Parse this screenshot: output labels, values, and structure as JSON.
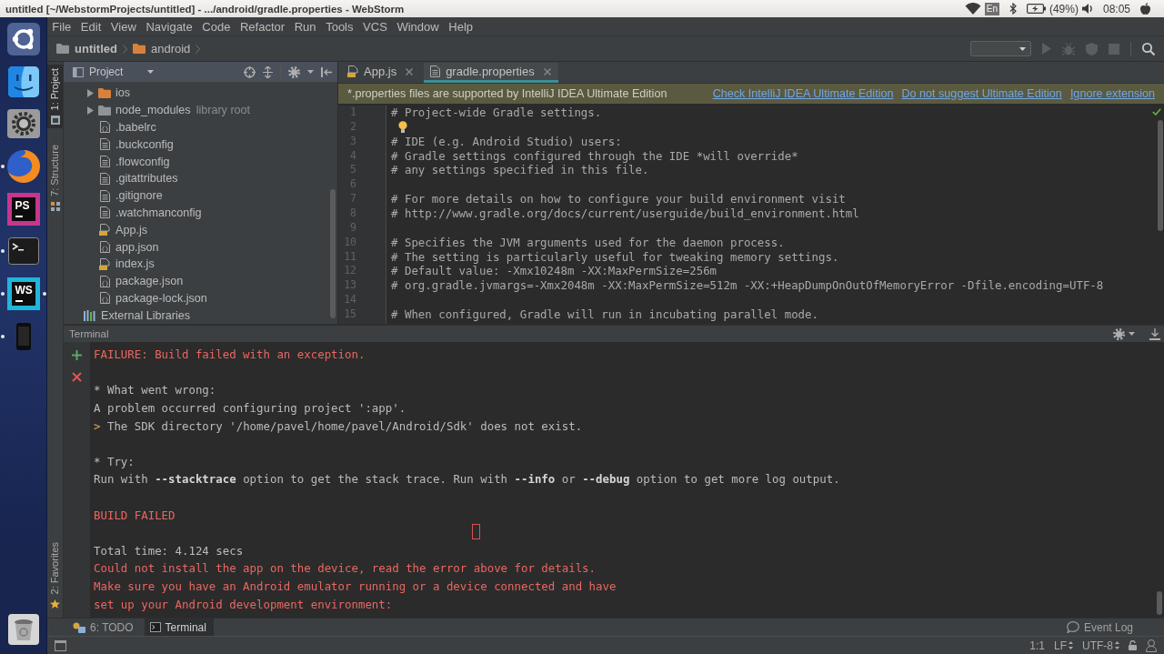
{
  "top_bar": {
    "title": "untitled [~/WebstormProjects/untitled] - .../android/gradle.properties - WebStorm",
    "keyboard_layout": "En",
    "battery": "(49%)",
    "clock": "08:05"
  },
  "launcher": {
    "items": [
      {
        "kind": "dash",
        "running": false,
        "focused": false
      },
      {
        "kind": "files",
        "running": false,
        "focused": false
      },
      {
        "kind": "settings",
        "running": false,
        "focused": false
      },
      {
        "kind": "browser",
        "running": true,
        "focused": false
      },
      {
        "kind": "ide",
        "label": "PS",
        "color": "#c8358e",
        "running": false,
        "focused": false
      },
      {
        "kind": "terminal",
        "running": true,
        "focused": false
      },
      {
        "kind": "ide",
        "label": "WS",
        "color": "#1fb5dc",
        "running": true,
        "focused": true
      },
      {
        "kind": "phone",
        "running": true,
        "focused": false
      }
    ],
    "bottom_items": [
      {
        "kind": "trash",
        "running": false,
        "focused": false
      }
    ]
  },
  "menu": [
    "File",
    "Edit",
    "View",
    "Navigate",
    "Code",
    "Refactor",
    "Run",
    "Tools",
    "VCS",
    "Window",
    "Help"
  ],
  "navigation_bar": {
    "breadcrumbs": [
      {
        "label": "untitled",
        "kind": "module"
      },
      {
        "label": "android",
        "kind": "folder"
      }
    ],
    "run_toolbar": [
      {
        "kind": "run",
        "disabled": true
      },
      {
        "kind": "debug",
        "disabled": true
      },
      {
        "kind": "coverage",
        "disabled": true
      },
      {
        "kind": "stop",
        "disabled": true
      }
    ]
  },
  "tool_strip": {
    "top": [
      {
        "label": "1: Project",
        "kind": "project",
        "selected": true
      },
      {
        "label": "7: Structure",
        "kind": "structure",
        "selected": false
      }
    ],
    "bottom": [
      {
        "label": "2: Favorites",
        "kind": "favorites",
        "selected": false
      }
    ]
  },
  "project_panel": {
    "title": "Project",
    "items": [
      {
        "label": "ios",
        "kind": "folder",
        "expanded": false
      },
      {
        "label": "node_modules",
        "kind": "library-folder",
        "note": "library root",
        "expanded": false
      },
      {
        "label": ".babelrc",
        "kind": "config-file"
      },
      {
        "label": ".buckconfig",
        "kind": "text-file"
      },
      {
        "label": ".flowconfig",
        "kind": "text-file"
      },
      {
        "label": ".gitattributes",
        "kind": "text-file"
      },
      {
        "label": ".gitignore",
        "kind": "text-file"
      },
      {
        "label": ".watchmanconfig",
        "kind": "text-file"
      },
      {
        "label": "App.js",
        "kind": "js-file"
      },
      {
        "label": "app.json",
        "kind": "config-file"
      },
      {
        "label": "index.js",
        "kind": "js-file"
      },
      {
        "label": "package.json",
        "kind": "config-file"
      },
      {
        "label": "package-lock.json",
        "kind": "config-file"
      }
    ],
    "external_libraries": "External Libraries"
  },
  "editor": {
    "tabs": [
      {
        "label": "App.js",
        "kind": "js",
        "selected": false
      },
      {
        "label": "gradle.properties",
        "kind": "properties",
        "selected": true
      }
    ],
    "notice": {
      "text": "*.properties files are supported by IntelliJ IDEA Ultimate Edition",
      "links": [
        "Check IntelliJ IDEA Ultimate Edition",
        "Do not suggest Ultimate Edition",
        "Ignore extension"
      ]
    },
    "lines": [
      {
        "number": "1",
        "text": "# Project-wide Gradle settings.",
        "intention": false
      },
      {
        "number": "2",
        "intention": true
      },
      {
        "number": "3",
        "text": "# IDE (e.g. Android Studio) users:",
        "intention": false
      },
      {
        "number": "4",
        "text": "# Gradle settings configured through the IDE *will override*",
        "intention": false
      },
      {
        "number": "5",
        "text": "# any settings specified in this file.",
        "intention": false
      },
      {
        "number": "6",
        "intention": false
      },
      {
        "number": "7",
        "text": "# For more details on how to configure your build environment visit",
        "intention": false
      },
      {
        "number": "8",
        "text": "# http://www.gradle.org/docs/current/userguide/build_environment.html",
        "intention": false
      },
      {
        "number": "9",
        "intention": false
      },
      {
        "number": "10",
        "text": "# Specifies the JVM arguments used for the daemon process.",
        "intention": false
      },
      {
        "number": "11",
        "text": "# The setting is particularly useful for tweaking memory settings.",
        "intention": false
      },
      {
        "number": "12",
        "text": "# Default value: -Xmx10248m -XX:MaxPermSize=256m",
        "intention": false
      },
      {
        "number": "13",
        "text": "# org.gradle.jvmargs=-Xmx2048m -XX:MaxPermSize=512m -XX:+HeapDumpOnOutOfMemoryError -Dfile.encoding=UTF-8",
        "intention": false
      },
      {
        "number": "14",
        "intention": false
      },
      {
        "number": "15",
        "text": "# When configured, Gradle will run in incubating parallel mode.",
        "intention": false
      }
    ]
  },
  "terminal": {
    "title": "Terminal",
    "blocks": [
      {
        "lines": [
          {
            "kind": "error",
            "text": "FAILURE: Build failed with an exception."
          }
        ]
      },
      {
        "lines": [
          {
            "kind": "plain",
            "text": "* What went wrong:"
          },
          {
            "kind": "plain",
            "text": "A problem occurred configuring project ':app'."
          },
          {
            "kind": "plain",
            "marker": ">",
            "text": "The SDK directory '/home/pavel/home/pavel/Android/Sdk' does not exist."
          }
        ]
      },
      {
        "lines": [
          {
            "kind": "plain",
            "text": "* Try:"
          },
          {
            "kind": "plain",
            "text": "Run with **--stacktrace** option to get the stack trace. Run with **--info** or **--debug** option to get more log output."
          }
        ]
      },
      {
        "lines": [
          {
            "kind": "error",
            "text": "BUILD FAILED"
          }
        ]
      },
      {
        "lines": [
          {
            "kind": "plain",
            "text": "Total time: 4.124 secs"
          },
          {
            "kind": "error",
            "text": "Could not install the app on the device, read the error above for details."
          },
          {
            "kind": "error",
            "text": "Make sure you have an Android emulator running or a device connected and have"
          },
          {
            "kind": "error",
            "text": "set up your Android development environment:"
          }
        ]
      }
    ]
  },
  "bottom_bar": {
    "tool_windows": [
      {
        "label": "6: TODO",
        "kind": "todo",
        "selected": false
      },
      {
        "label": "Terminal",
        "kind": "terminal",
        "selected": true
      }
    ],
    "event_log": "Event Log"
  },
  "status_bar": {
    "position": "1:1",
    "line_separator": "LF",
    "encoding": "UTF-8"
  }
}
